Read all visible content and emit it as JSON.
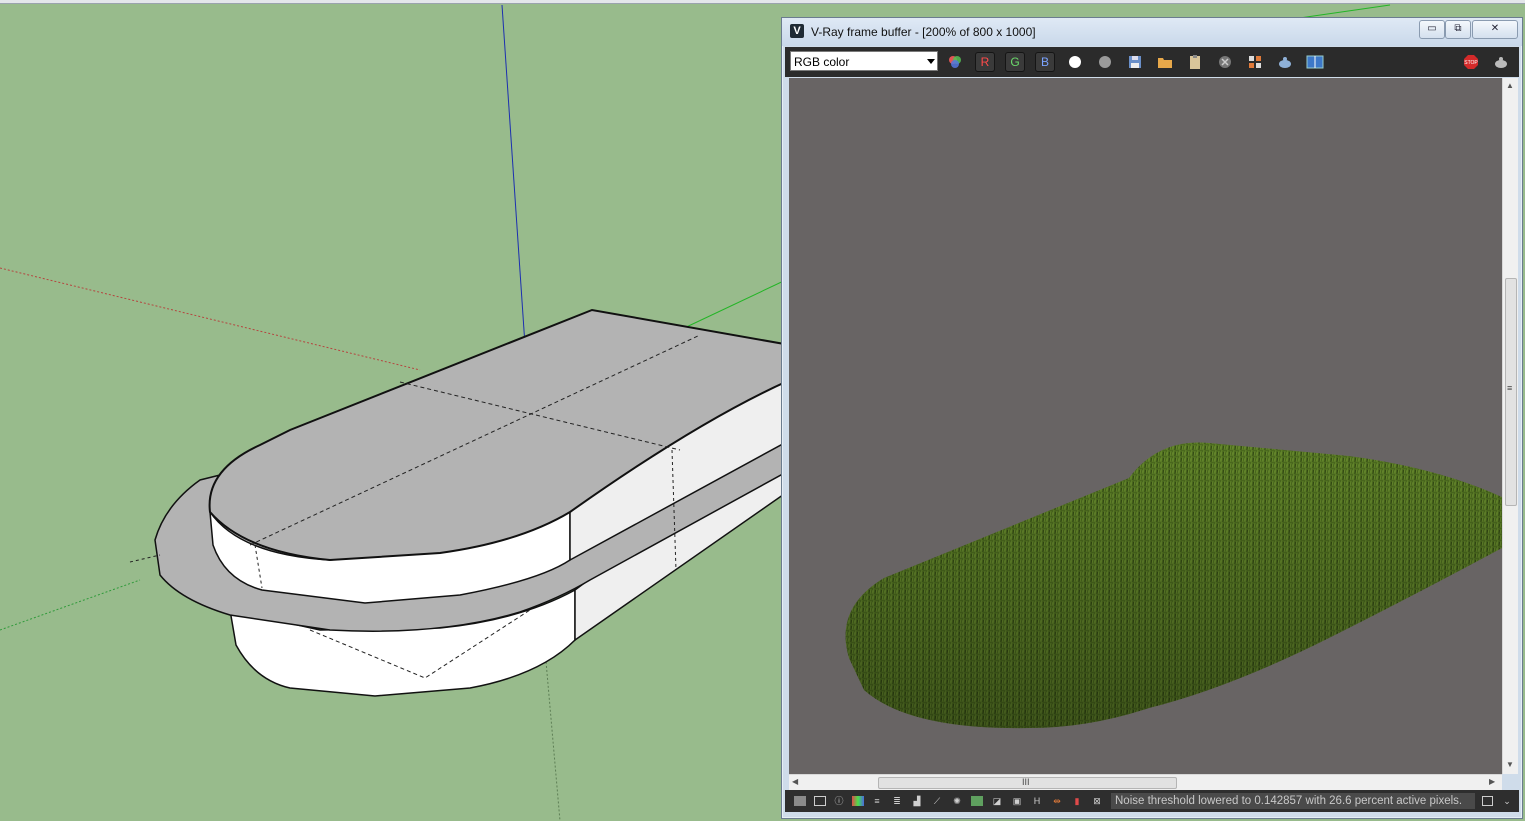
{
  "sketchup": {
    "viewport_bg": "#98bb8c",
    "model_face_color": "#b3b3b3",
    "model_side_color": "#ffffff"
  },
  "vfb": {
    "title": "V-Ray frame buffer - [200% of 800 x 1000]",
    "logo_glyph": "V",
    "window_buttons": {
      "minimize": "▭",
      "maximize": "⧉",
      "close": "✕"
    },
    "channel_select": "RGB color",
    "channel_buttons": {
      "r": "R",
      "g": "G",
      "b": "B"
    },
    "toolbar_icons": [
      "color-mode-icon",
      "red-channel",
      "green-channel",
      "blue-channel",
      "white-circle-icon",
      "gray-circle-icon",
      "save-icon",
      "open-folder-icon",
      "clipboard-icon",
      "clear-icon",
      "region-render-icon",
      "teapot-render-icon",
      "compare-icon",
      "stop-icon",
      "teapot-icon"
    ],
    "status_text": "Noise threshold lowered to 0.142857 with 26.6 percent active pixels.",
    "hscroll_grip": "III",
    "vscroll_grip": "≡",
    "render_bg": "#686464",
    "grass_color": "#4b6a1e"
  }
}
